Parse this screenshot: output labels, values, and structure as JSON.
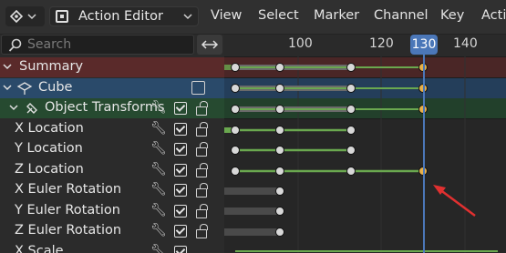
{
  "header": {
    "editor_type_icon": "dope-sheet-icon",
    "mode_label": "Action Editor",
    "menus": [
      "View",
      "Select",
      "Marker",
      "Channel",
      "Key",
      "Actio"
    ]
  },
  "search": {
    "placeholder": "Search"
  },
  "timeline": {
    "ruler_ticks": [
      "100",
      "120",
      "140"
    ],
    "current_frame": "130"
  },
  "channels": {
    "summary": "Summary",
    "object": "Cube",
    "group": "Object Transforms",
    "items": [
      "X Location",
      "Y Location",
      "Z Location",
      "X Euler Rotation",
      "Y Euler Rotation",
      "Z Euler Rotation",
      "X Scale"
    ]
  },
  "colors": {
    "summary_row": "#5a2a2a",
    "object_row": "#2a4a6a",
    "group_row": "#264a30",
    "current_frame": "#4b77b8",
    "hold_bar": "#6aa84f",
    "selected_key": "#e8b04a",
    "annotation_arrow": "#e03030"
  }
}
